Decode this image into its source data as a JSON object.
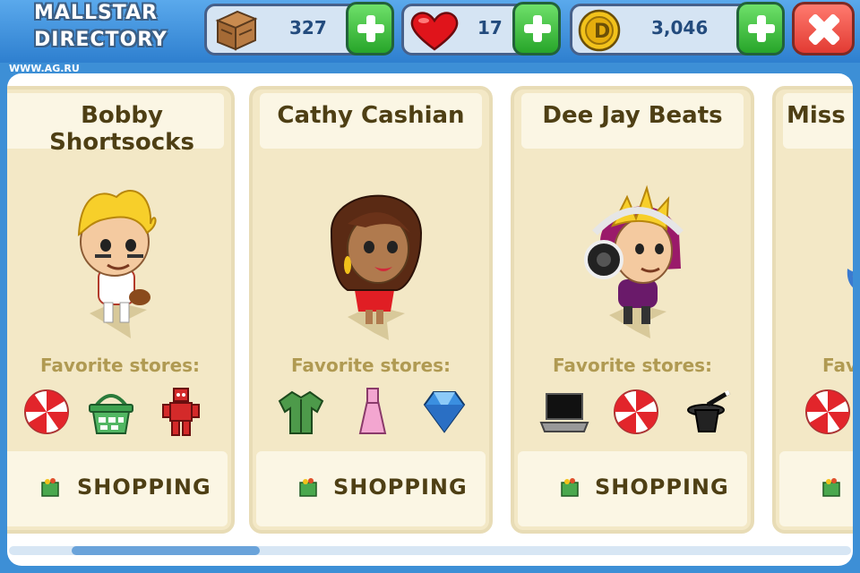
{
  "header": {
    "title_line1": "MALLSTAR",
    "title_line2": "DIRECTORY",
    "watermark": "WWW.AG.RU"
  },
  "stats": {
    "crates": "327",
    "hearts": "17",
    "coins": "3,046"
  },
  "cards": [
    {
      "name": "Bobby Shortsocks",
      "favorite_label": "Favorite stores:",
      "stores": [
        "candy-icon",
        "basket-icon",
        "robot-icon"
      ],
      "action_label": "SHOPPING"
    },
    {
      "name": "Cathy Cashian",
      "favorite_label": "Favorite stores:",
      "stores": [
        "shirt-icon",
        "dress-icon",
        "diamond-icon"
      ],
      "action_label": "SHOPPING"
    },
    {
      "name": "Dee Jay Beats",
      "favorite_label": "Favorite stores:",
      "stores": [
        "laptop-icon",
        "candy-icon",
        "magic-hat-icon"
      ],
      "action_label": "SHOPPING"
    },
    {
      "name": "Miss P",
      "favorite_label": "Fav",
      "stores": [
        "candy-icon"
      ],
      "action_label": ""
    }
  ],
  "colors": {
    "top_bar": "#3d8fd6",
    "card_bg": "#f3e8c6",
    "text_brown": "#4e3f14",
    "plus_green": "#27a529",
    "close_red": "#e23b33"
  }
}
